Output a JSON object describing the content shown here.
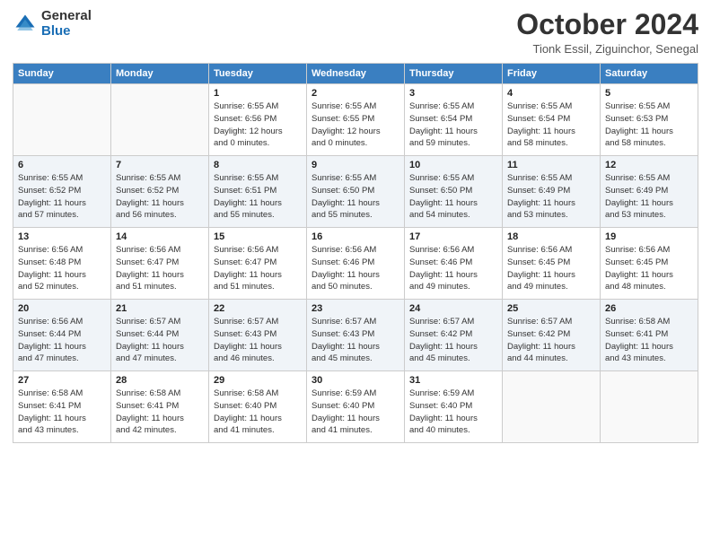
{
  "header": {
    "logo_general": "General",
    "logo_blue": "Blue",
    "month_title": "October 2024",
    "subtitle": "Tionk Essil, Ziguinchor, Senegal"
  },
  "days_of_week": [
    "Sunday",
    "Monday",
    "Tuesday",
    "Wednesday",
    "Thursday",
    "Friday",
    "Saturday"
  ],
  "weeks": [
    [
      {
        "day": "",
        "info": ""
      },
      {
        "day": "",
        "info": ""
      },
      {
        "day": "1",
        "info": "Sunrise: 6:55 AM\nSunset: 6:56 PM\nDaylight: 12 hours\nand 0 minutes."
      },
      {
        "day": "2",
        "info": "Sunrise: 6:55 AM\nSunset: 6:55 PM\nDaylight: 12 hours\nand 0 minutes."
      },
      {
        "day": "3",
        "info": "Sunrise: 6:55 AM\nSunset: 6:54 PM\nDaylight: 11 hours\nand 59 minutes."
      },
      {
        "day": "4",
        "info": "Sunrise: 6:55 AM\nSunset: 6:54 PM\nDaylight: 11 hours\nand 58 minutes."
      },
      {
        "day": "5",
        "info": "Sunrise: 6:55 AM\nSunset: 6:53 PM\nDaylight: 11 hours\nand 58 minutes."
      }
    ],
    [
      {
        "day": "6",
        "info": "Sunrise: 6:55 AM\nSunset: 6:52 PM\nDaylight: 11 hours\nand 57 minutes."
      },
      {
        "day": "7",
        "info": "Sunrise: 6:55 AM\nSunset: 6:52 PM\nDaylight: 11 hours\nand 56 minutes."
      },
      {
        "day": "8",
        "info": "Sunrise: 6:55 AM\nSunset: 6:51 PM\nDaylight: 11 hours\nand 55 minutes."
      },
      {
        "day": "9",
        "info": "Sunrise: 6:55 AM\nSunset: 6:50 PM\nDaylight: 11 hours\nand 55 minutes."
      },
      {
        "day": "10",
        "info": "Sunrise: 6:55 AM\nSunset: 6:50 PM\nDaylight: 11 hours\nand 54 minutes."
      },
      {
        "day": "11",
        "info": "Sunrise: 6:55 AM\nSunset: 6:49 PM\nDaylight: 11 hours\nand 53 minutes."
      },
      {
        "day": "12",
        "info": "Sunrise: 6:55 AM\nSunset: 6:49 PM\nDaylight: 11 hours\nand 53 minutes."
      }
    ],
    [
      {
        "day": "13",
        "info": "Sunrise: 6:56 AM\nSunset: 6:48 PM\nDaylight: 11 hours\nand 52 minutes."
      },
      {
        "day": "14",
        "info": "Sunrise: 6:56 AM\nSunset: 6:47 PM\nDaylight: 11 hours\nand 51 minutes."
      },
      {
        "day": "15",
        "info": "Sunrise: 6:56 AM\nSunset: 6:47 PM\nDaylight: 11 hours\nand 51 minutes."
      },
      {
        "day": "16",
        "info": "Sunrise: 6:56 AM\nSunset: 6:46 PM\nDaylight: 11 hours\nand 50 minutes."
      },
      {
        "day": "17",
        "info": "Sunrise: 6:56 AM\nSunset: 6:46 PM\nDaylight: 11 hours\nand 49 minutes."
      },
      {
        "day": "18",
        "info": "Sunrise: 6:56 AM\nSunset: 6:45 PM\nDaylight: 11 hours\nand 49 minutes."
      },
      {
        "day": "19",
        "info": "Sunrise: 6:56 AM\nSunset: 6:45 PM\nDaylight: 11 hours\nand 48 minutes."
      }
    ],
    [
      {
        "day": "20",
        "info": "Sunrise: 6:56 AM\nSunset: 6:44 PM\nDaylight: 11 hours\nand 47 minutes."
      },
      {
        "day": "21",
        "info": "Sunrise: 6:57 AM\nSunset: 6:44 PM\nDaylight: 11 hours\nand 47 minutes."
      },
      {
        "day": "22",
        "info": "Sunrise: 6:57 AM\nSunset: 6:43 PM\nDaylight: 11 hours\nand 46 minutes."
      },
      {
        "day": "23",
        "info": "Sunrise: 6:57 AM\nSunset: 6:43 PM\nDaylight: 11 hours\nand 45 minutes."
      },
      {
        "day": "24",
        "info": "Sunrise: 6:57 AM\nSunset: 6:42 PM\nDaylight: 11 hours\nand 45 minutes."
      },
      {
        "day": "25",
        "info": "Sunrise: 6:57 AM\nSunset: 6:42 PM\nDaylight: 11 hours\nand 44 minutes."
      },
      {
        "day": "26",
        "info": "Sunrise: 6:58 AM\nSunset: 6:41 PM\nDaylight: 11 hours\nand 43 minutes."
      }
    ],
    [
      {
        "day": "27",
        "info": "Sunrise: 6:58 AM\nSunset: 6:41 PM\nDaylight: 11 hours\nand 43 minutes."
      },
      {
        "day": "28",
        "info": "Sunrise: 6:58 AM\nSunset: 6:41 PM\nDaylight: 11 hours\nand 42 minutes."
      },
      {
        "day": "29",
        "info": "Sunrise: 6:58 AM\nSunset: 6:40 PM\nDaylight: 11 hours\nand 41 minutes."
      },
      {
        "day": "30",
        "info": "Sunrise: 6:59 AM\nSunset: 6:40 PM\nDaylight: 11 hours\nand 41 minutes."
      },
      {
        "day": "31",
        "info": "Sunrise: 6:59 AM\nSunset: 6:40 PM\nDaylight: 11 hours\nand 40 minutes."
      },
      {
        "day": "",
        "info": ""
      },
      {
        "day": "",
        "info": ""
      }
    ]
  ]
}
